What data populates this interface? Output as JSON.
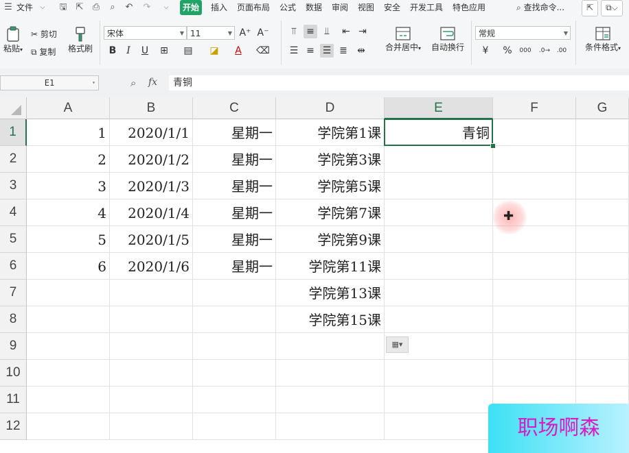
{
  "menubar": {
    "file_label": "文件",
    "tabs": [
      "开始",
      "插入",
      "页面布局",
      "公式",
      "数据",
      "审阅",
      "视图",
      "安全",
      "开发工具",
      "特色应用"
    ],
    "search_label": "查找命令..."
  },
  "ribbon": {
    "paste_label": "粘贴",
    "cut_label": "剪切",
    "copy_label": "复制",
    "format_painter_label": "格式刷",
    "font_name": "宋体",
    "font_size": "11",
    "merge_center_label": "合并居中",
    "wrap_text_label": "自动换行",
    "number_format": "常规",
    "conditional_format_label": "条件格式"
  },
  "formula_bar": {
    "name_box": "E1",
    "fx_label": "fx",
    "content": "青铜"
  },
  "sheet": {
    "columns": [
      "A",
      "B",
      "C",
      "D",
      "E",
      "F",
      "G"
    ],
    "rows": [
      "1",
      "2",
      "3",
      "4",
      "5",
      "6",
      "7",
      "8",
      "9",
      "10",
      "11",
      "12"
    ],
    "col_a": [
      "1",
      "2",
      "3",
      "4",
      "5",
      "6"
    ],
    "col_b": [
      "2020/1/1",
      "2020/1/2",
      "2020/1/3",
      "2020/1/4",
      "2020/1/5",
      "2020/1/6"
    ],
    "col_c": [
      "星期一",
      "星期一",
      "星期一",
      "星期一",
      "星期一",
      "星期一"
    ],
    "col_d": [
      "学院第1课",
      "学院第3课",
      "学院第5课",
      "学院第7课",
      "学院第9课",
      "学院第11课",
      "学院第13课",
      "学院第15课"
    ],
    "col_e": [
      "青铜"
    ],
    "selected_cell": "E1"
  },
  "watermark": "职场啊森",
  "colors": {
    "accent": "#217346",
    "active_tab": "#21a366",
    "watermark_text": "#d61cc8"
  }
}
